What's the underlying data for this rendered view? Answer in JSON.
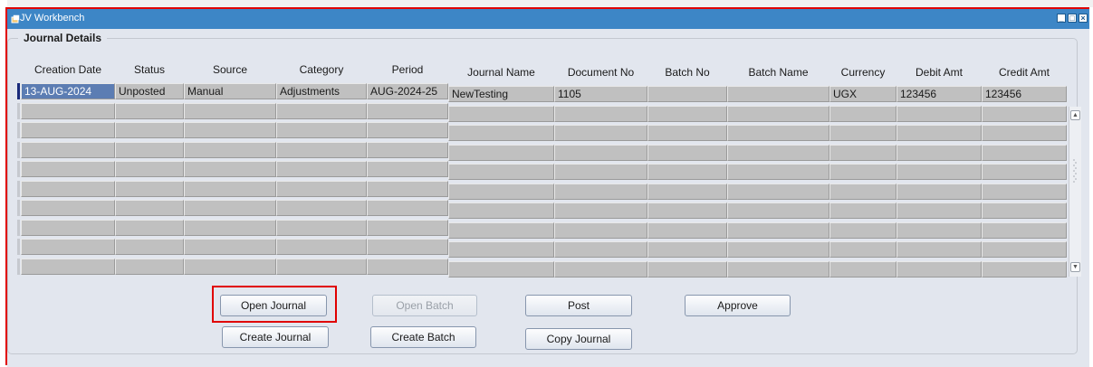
{
  "window": {
    "title": "JV Workbench"
  },
  "group": {
    "title": "Journal Details"
  },
  "table": {
    "columns": [
      "Creation Date",
      "Status",
      "Source",
      "Category",
      "Period",
      "Journal Name",
      "Document No",
      "Batch No",
      "Batch Name",
      "Currency",
      "Debit Amt",
      "Credit Amt"
    ],
    "rows": [
      [
        "13-AUG-2024",
        "Unposted",
        "Manual",
        "Adjustments",
        "AUG-2024-25",
        "NewTesting",
        "1105",
        "",
        "",
        "UGX",
        "123456",
        "123456"
      ],
      [
        "",
        "",
        "",
        "",
        "",
        "",
        "",
        "",
        "",
        "",
        "",
        ""
      ],
      [
        "",
        "",
        "",
        "",
        "",
        "",
        "",
        "",
        "",
        "",
        "",
        ""
      ],
      [
        "",
        "",
        "",
        "",
        "",
        "",
        "",
        "",
        "",
        "",
        "",
        ""
      ],
      [
        "",
        "",
        "",
        "",
        "",
        "",
        "",
        "",
        "",
        "",
        "",
        ""
      ],
      [
        "",
        "",
        "",
        "",
        "",
        "",
        "",
        "",
        "",
        "",
        "",
        ""
      ],
      [
        "",
        "",
        "",
        "",
        "",
        "",
        "",
        "",
        "",
        "",
        "",
        ""
      ],
      [
        "",
        "",
        "",
        "",
        "",
        "",
        "",
        "",
        "",
        "",
        "",
        ""
      ],
      [
        "",
        "",
        "",
        "",
        "",
        "",
        "",
        "",
        "",
        "",
        "",
        ""
      ],
      [
        "",
        "",
        "",
        "",
        "",
        "",
        "",
        "",
        "",
        "",
        "",
        ""
      ]
    ],
    "selected_row": 0
  },
  "buttons": {
    "open_journal": "Open Journal",
    "open_batch": "Open Batch",
    "post": "Post",
    "approve": "Approve",
    "create_journal": "Create Journal",
    "create_batch": "Create Batch",
    "copy_journal": "Copy Journal"
  },
  "colors": {
    "titlebar": "#3d86c6",
    "window_bg": "#e2e6ee",
    "cell_bg": "#c0c0c0",
    "selection": "#5c7db3",
    "highlight": "#e00000"
  },
  "icons": {
    "window_icon": "window-app-icon",
    "minimize": "minimize-icon",
    "maximize": "maximize-icon",
    "close": "close-icon",
    "scroll_up": "chevron-up-icon",
    "scroll_down": "chevron-down-icon"
  }
}
